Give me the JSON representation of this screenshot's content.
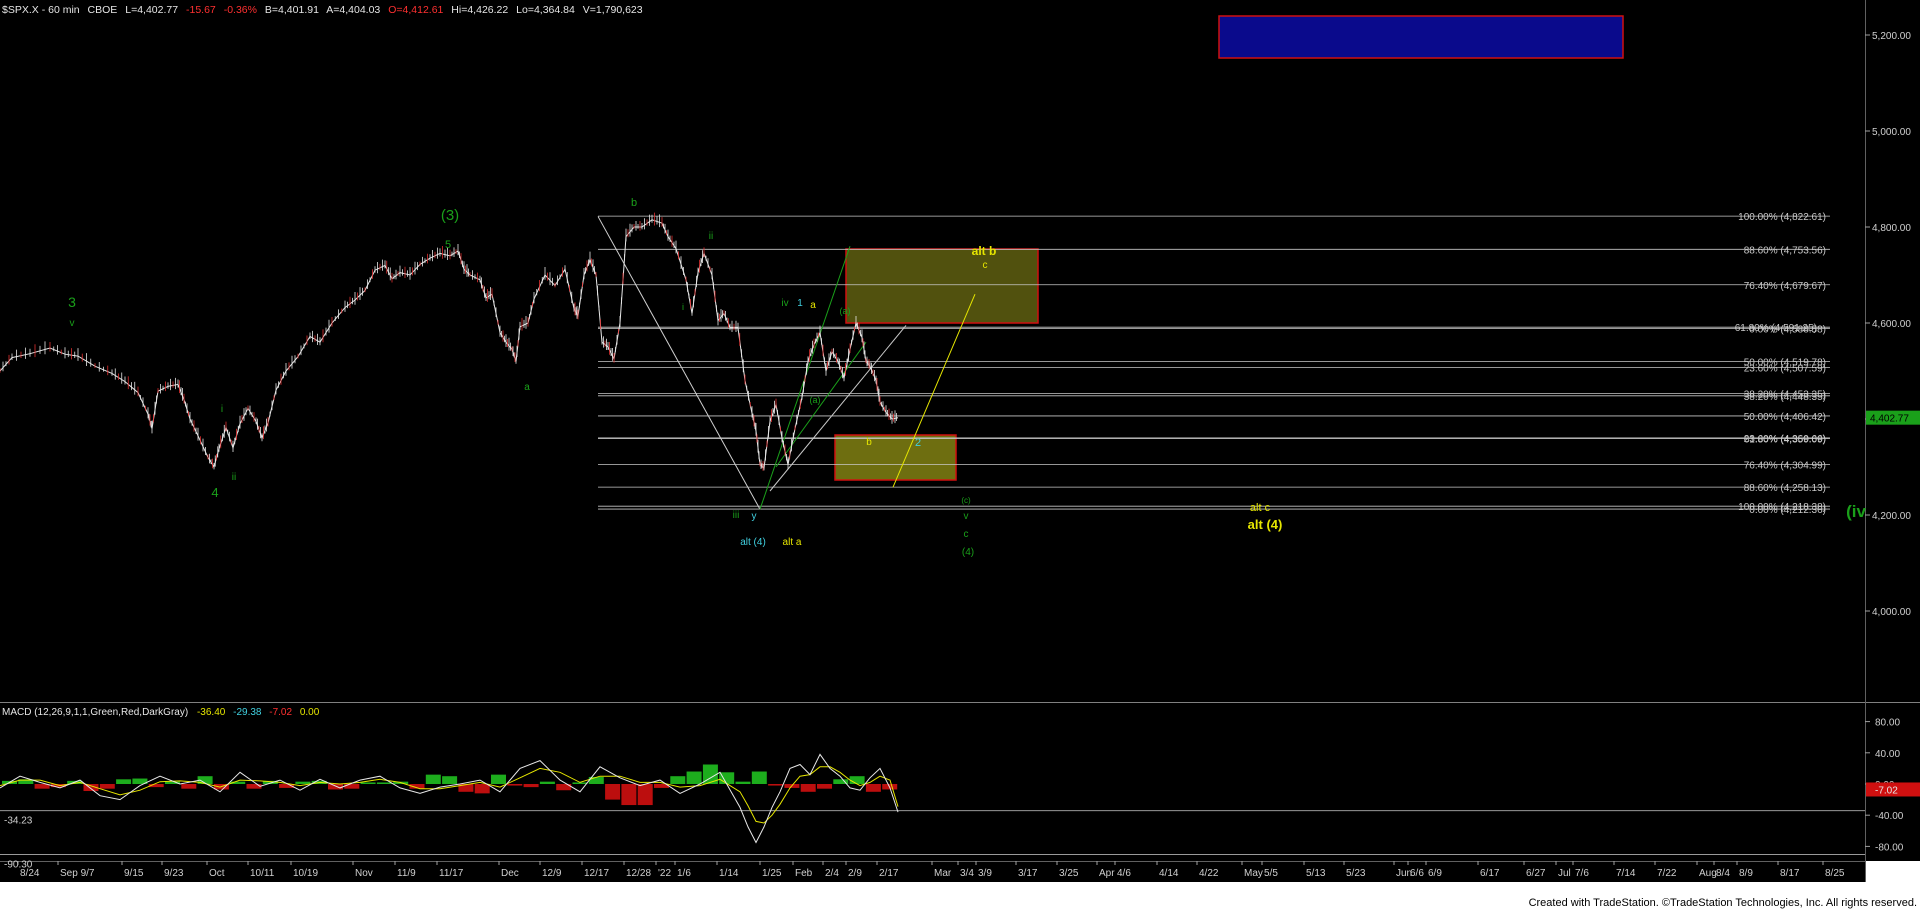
{
  "header": {
    "symbol": "$SPX.X - 60 min",
    "exchange": "CBOE",
    "last": "L=4,402.77",
    "change": "-15.67",
    "pct": "-0.36%",
    "bid": "B=4,401.91",
    "ask": "A=4,404.03",
    "open": "O=4,412.61",
    "high": "Hi=4,426.22",
    "low": "Lo=4,364.84",
    "volume": "V=1,790,623"
  },
  "footer": {
    "credit": "Created with TradeStation. ©TradeStation Technologies, Inc. All rights reserved."
  },
  "colors": {
    "background": "#000000",
    "price_line": "#ffffff",
    "wave_green": "#1aa01a",
    "wave_yellow": "#e6e600",
    "wave_cyan": "#40d0e0",
    "box_blue": "#0a0a8c",
    "box_red": "#c01010",
    "box_olive": "#6e6e10",
    "macd_green": "#20c020",
    "macd_red": "#d01010"
  },
  "chart_data": [
    {
      "type": "line",
      "panel": "price",
      "y_axis_ticks": [
        4000,
        4200,
        4400,
        4600,
        4800,
        5000,
        5200
      ],
      "y_tick_labels": [
        "4,000.00",
        "4,200.00",
        "4,400.00",
        "4,600.00",
        "4,800.00",
        "5,000.00",
        "5,200.00"
      ],
      "ylim": [
        3740,
        5285
      ],
      "last_price_label": "4,402.77",
      "x_tick_labels": [
        "8/24",
        "Sep 9/7",
        "9/15",
        "9/23",
        "Oct",
        "10/11",
        "10/19",
        "Nov",
        "11/9",
        "11/17",
        "Dec",
        "12/9",
        "12/17",
        "12/28",
        "'22",
        "1/6",
        "1/14",
        "1/25",
        "Feb",
        "2/4",
        "2/9",
        "2/17",
        "Mar",
        "3/4",
        "3/9",
        "3/17",
        "3/25",
        "Apr",
        "4/6",
        "4/14",
        "4/22",
        "May",
        "5/5",
        "5/13",
        "5/23",
        "Jun",
        "6/6",
        "6/9",
        "6/17",
        "6/27",
        "Jul",
        "7/6",
        "7/14",
        "7/22",
        "Aug",
        "8/4",
        "8/9",
        "8/17",
        "8/25"
      ],
      "price_path": [
        [
          0,
          4500
        ],
        [
          12,
          4528
        ],
        [
          30,
          4536
        ],
        [
          50,
          4548
        ],
        [
          65,
          4535
        ],
        [
          78,
          4531
        ],
        [
          95,
          4510
        ],
        [
          112,
          4495
        ],
        [
          125,
          4478
        ],
        [
          138,
          4455
        ],
        [
          148,
          4410
        ],
        [
          152,
          4380
        ],
        [
          158,
          4458
        ],
        [
          168,
          4468
        ],
        [
          178,
          4472
        ],
        [
          184,
          4440
        ],
        [
          190,
          4400
        ],
        [
          198,
          4365
        ],
        [
          208,
          4320
        ],
        [
          214,
          4300
        ],
        [
          219,
          4338
        ],
        [
          226,
          4382
        ],
        [
          233,
          4340
        ],
        [
          240,
          4390
        ],
        [
          248,
          4422
        ],
        [
          256,
          4395
        ],
        [
          262,
          4360
        ],
        [
          268,
          4392
        ],
        [
          276,
          4460
        ],
        [
          286,
          4500
        ],
        [
          298,
          4530
        ],
        [
          310,
          4572
        ],
        [
          320,
          4560
        ],
        [
          332,
          4600
        ],
        [
          345,
          4632
        ],
        [
          355,
          4648
        ],
        [
          365,
          4668
        ],
        [
          375,
          4710
        ],
        [
          385,
          4720
        ],
        [
          392,
          4692
        ],
        [
          400,
          4705
        ],
        [
          410,
          4700
        ],
        [
          420,
          4722
        ],
        [
          430,
          4735
        ],
        [
          440,
          4745
        ],
        [
          450,
          4740
        ],
        [
          458,
          4750
        ],
        [
          464,
          4712
        ],
        [
          470,
          4700
        ],
        [
          480,
          4690
        ],
        [
          486,
          4652
        ],
        [
          492,
          4660
        ],
        [
          500,
          4580
        ],
        [
          506,
          4560
        ],
        [
          512,
          4545
        ],
        [
          516,
          4520
        ],
        [
          520,
          4592
        ],
        [
          528,
          4600
        ],
        [
          534,
          4650
        ],
        [
          545,
          4700
        ],
        [
          555,
          4678
        ],
        [
          565,
          4712
        ],
        [
          574,
          4630
        ],
        [
          578,
          4615
        ],
        [
          584,
          4700
        ],
        [
          590,
          4732
        ],
        [
          596,
          4700
        ],
        [
          602,
          4560
        ],
        [
          608,
          4550
        ],
        [
          614,
          4525
        ],
        [
          620,
          4600
        ],
        [
          626,
          4780
        ],
        [
          634,
          4800
        ],
        [
          642,
          4800
        ],
        [
          652,
          4815
        ],
        [
          662,
          4808
        ],
        [
          668,
          4780
        ],
        [
          676,
          4755
        ],
        [
          686,
          4690
        ],
        [
          692,
          4620
        ],
        [
          698,
          4705
        ],
        [
          704,
          4745
        ],
        [
          712,
          4700
        ],
        [
          718,
          4605
        ],
        [
          724,
          4620
        ],
        [
          730,
          4590
        ],
        [
          738,
          4590
        ],
        [
          745,
          4480
        ],
        [
          752,
          4412
        ],
        [
          756,
          4375
        ],
        [
          760,
          4305
        ],
        [
          764,
          4298
        ],
        [
          770,
          4395
        ],
        [
          776,
          4430
        ],
        [
          782,
          4360
        ],
        [
          788,
          4305
        ],
        [
          795,
          4380
        ],
        [
          802,
          4445
        ],
        [
          808,
          4520
        ],
        [
          814,
          4555
        ],
        [
          820,
          4580
        ],
        [
          826,
          4500
        ],
        [
          832,
          4540
        ],
        [
          838,
          4520
        ],
        [
          844,
          4485
        ],
        [
          850,
          4545
        ],
        [
          856,
          4600
        ],
        [
          862,
          4570
        ],
        [
          866,
          4520
        ],
        [
          870,
          4510
        ],
        [
          876,
          4480
        ],
        [
          880,
          4435
        ],
        [
          886,
          4414
        ],
        [
          892,
          4400
        ],
        [
          898,
          4402.77
        ]
      ],
      "fib_levels": [
        {
          "label": "100.00% (4,822.61)",
          "value": 4822.61
        },
        {
          "label": "88.60% (4,753.56)",
          "value": 4753.56
        },
        {
          "label": "76.40% (4,679.67)",
          "value": 4679.67
        },
        {
          "label": "61.80% (4,591.25)",
          "value": 4591.25
        },
        {
          "label": "0.00% (4,588.58)",
          "value": 4588.58
        },
        {
          "label": "50.00% (4,519.78)",
          "value": 4519.78
        },
        {
          "label": "23.60% (4,507.59)",
          "value": 4507.59
        },
        {
          "label": "38.20% (4,448.35)",
          "value": 4448.35
        },
        {
          "label": "38.20% (4,453.35)",
          "value": 4453.35
        },
        {
          "label": "50.00% (4,406.42)",
          "value": 4406.42
        },
        {
          "label": "61.80% (4,359.09)",
          "value": 4359.09
        },
        {
          "label": "23.60% (4,360.66)",
          "value": 4360.66
        },
        {
          "label": "76.40% (4,304.99)",
          "value": 4304.99
        },
        {
          "label": "88.60% (4,258.13)",
          "value": 4258.13
        },
        {
          "label": "100.00% (4,218.38)",
          "value": 4218.38
        },
        {
          "label": "0.00% (4,212.36)",
          "value": 4212.36
        }
      ],
      "wave_labels": [
        {
          "text": "3",
          "color": "green"
        },
        {
          "text": "v",
          "color": "green"
        },
        {
          "text": "4",
          "color": "green"
        },
        {
          "text": "ii",
          "color": "green"
        },
        {
          "text": "i",
          "color": "green"
        },
        {
          "text": "(3)",
          "color": "green"
        },
        {
          "text": "5",
          "color": "green"
        },
        {
          "text": "a",
          "color": "green"
        },
        {
          "text": "b",
          "color": "green"
        },
        {
          "text": "ii",
          "color": "green"
        },
        {
          "text": "i",
          "color": "green"
        },
        {
          "text": "iii",
          "color": "green"
        },
        {
          "text": "y",
          "color": "cyan"
        },
        {
          "text": "alt (4)",
          "color": "cyan"
        },
        {
          "text": "alt a",
          "color": "yellow"
        },
        {
          "text": "iv",
          "color": "green"
        },
        {
          "text": "1",
          "color": "cyan"
        },
        {
          "text": "a",
          "color": "yellow"
        },
        {
          "text": "(a)",
          "color": "green"
        },
        {
          "text": "(a)",
          "color": "green"
        },
        {
          "text": "b",
          "color": "yellow"
        },
        {
          "text": "2",
          "color": "cyan"
        },
        {
          "text": "alt b",
          "color": "yellow"
        },
        {
          "text": "c",
          "color": "yellow"
        },
        {
          "text": "(c)",
          "color": "green"
        },
        {
          "text": "v",
          "color": "green"
        },
        {
          "text": "c",
          "color": "green"
        },
        {
          "text": "(4)",
          "color": "green"
        },
        {
          "text": "alt c",
          "color": "yellow"
        },
        {
          "text": "alt (4)",
          "color": "yellow"
        },
        {
          "text": "(iv",
          "color": "green"
        }
      ]
    },
    {
      "type": "line",
      "panel": "macd",
      "title": "MACD (12,26,9,1,1,Green,Red,DarkGray)",
      "values": [
        "-36.40",
        "-29.38",
        "-7.02",
        "0.00"
      ],
      "y_axis_ticks": [
        -80,
        -40,
        0,
        40,
        80
      ],
      "y_tick_labels": [
        "-80.00",
        "-40.00",
        "0.00",
        "40.00",
        "80.00"
      ],
      "ylim": [
        -100,
        100
      ],
      "ref_lines": [
        {
          "label": "-34.23",
          "value": -34.23
        },
        {
          "label": "-90.30",
          "value": -90.3
        }
      ],
      "last_label": "-7.02",
      "macd_path": [
        [
          0,
          -5
        ],
        [
          20,
          10
        ],
        [
          40,
          2
        ],
        [
          60,
          -5
        ],
        [
          80,
          5
        ],
        [
          100,
          -15
        ],
        [
          120,
          -20
        ],
        [
          140,
          -2
        ],
        [
          160,
          10
        ],
        [
          180,
          0
        ],
        [
          200,
          5
        ],
        [
          220,
          -10
        ],
        [
          240,
          15
        ],
        [
          260,
          -3
        ],
        [
          280,
          5
        ],
        [
          300,
          -8
        ],
        [
          320,
          6
        ],
        [
          340,
          -5
        ],
        [
          360,
          5
        ],
        [
          380,
          10
        ],
        [
          400,
          -5
        ],
        [
          420,
          -12
        ],
        [
          440,
          -4
        ],
        [
          460,
          0
        ],
        [
          480,
          5
        ],
        [
          500,
          -10
        ],
        [
          520,
          20
        ],
        [
          540,
          30
        ],
        [
          560,
          5
        ],
        [
          580,
          -10
        ],
        [
          600,
          22
        ],
        [
          620,
          8
        ],
        [
          640,
          -2
        ],
        [
          660,
          5
        ],
        [
          680,
          -12
        ],
        [
          700,
          0
        ],
        [
          720,
          15
        ],
        [
          740,
          -30
        ],
        [
          748,
          -55
        ],
        [
          756,
          -75
        ],
        [
          764,
          -55
        ],
        [
          772,
          -30
        ],
        [
          780,
          -10
        ],
        [
          790,
          20
        ],
        [
          800,
          25
        ],
        [
          810,
          12
        ],
        [
          820,
          38
        ],
        [
          830,
          20
        ],
        [
          840,
          10
        ],
        [
          850,
          -5
        ],
        [
          860,
          -8
        ],
        [
          870,
          8
        ],
        [
          880,
          20
        ],
        [
          890,
          -5
        ],
        [
          898,
          -36
        ]
      ],
      "signal_path": [
        [
          0,
          -2
        ],
        [
          20,
          5
        ],
        [
          40,
          5
        ],
        [
          60,
          -2
        ],
        [
          80,
          2
        ],
        [
          100,
          -6
        ],
        [
          120,
          -14
        ],
        [
          140,
          -8
        ],
        [
          160,
          3
        ],
        [
          180,
          4
        ],
        [
          200,
          2
        ],
        [
          220,
          -4
        ],
        [
          240,
          5
        ],
        [
          260,
          4
        ],
        [
          280,
          2
        ],
        [
          300,
          -2
        ],
        [
          320,
          2
        ],
        [
          340,
          0
        ],
        [
          360,
          2
        ],
        [
          380,
          6
        ],
        [
          400,
          2
        ],
        [
          420,
          -6
        ],
        [
          440,
          -6
        ],
        [
          460,
          -2
        ],
        [
          480,
          2
        ],
        [
          500,
          -4
        ],
        [
          520,
          8
        ],
        [
          540,
          20
        ],
        [
          560,
          15
        ],
        [
          580,
          2
        ],
        [
          600,
          10
        ],
        [
          620,
          10
        ],
        [
          640,
          2
        ],
        [
          660,
          2
        ],
        [
          680,
          -4
        ],
        [
          700,
          -2
        ],
        [
          720,
          6
        ],
        [
          740,
          -10
        ],
        [
          748,
          -28
        ],
        [
          756,
          -48
        ],
        [
          764,
          -50
        ],
        [
          772,
          -40
        ],
        [
          780,
          -26
        ],
        [
          790,
          -5
        ],
        [
          800,
          10
        ],
        [
          810,
          12
        ],
        [
          820,
          22
        ],
        [
          830,
          22
        ],
        [
          840,
          15
        ],
        [
          850,
          5
        ],
        [
          860,
          -2
        ],
        [
          870,
          2
        ],
        [
          880,
          10
        ],
        [
          890,
          5
        ],
        [
          898,
          -29
        ]
      ],
      "histogram": [
        4,
        6,
        -6,
        -4,
        4,
        -9,
        -6,
        6,
        7,
        -4,
        3,
        -6,
        10,
        -7,
        3,
        -6,
        4,
        -5,
        3,
        4,
        -7,
        -6,
        2,
        2,
        3,
        -6,
        12,
        10,
        -10,
        -12,
        12,
        -2,
        -4,
        3,
        -8,
        2,
        9,
        -20,
        -27,
        -27,
        -5,
        10,
        16,
        25,
        15,
        3,
        16,
        -2,
        -5,
        -10,
        -6,
        6,
        10,
        -10,
        -7
      ]
    }
  ]
}
